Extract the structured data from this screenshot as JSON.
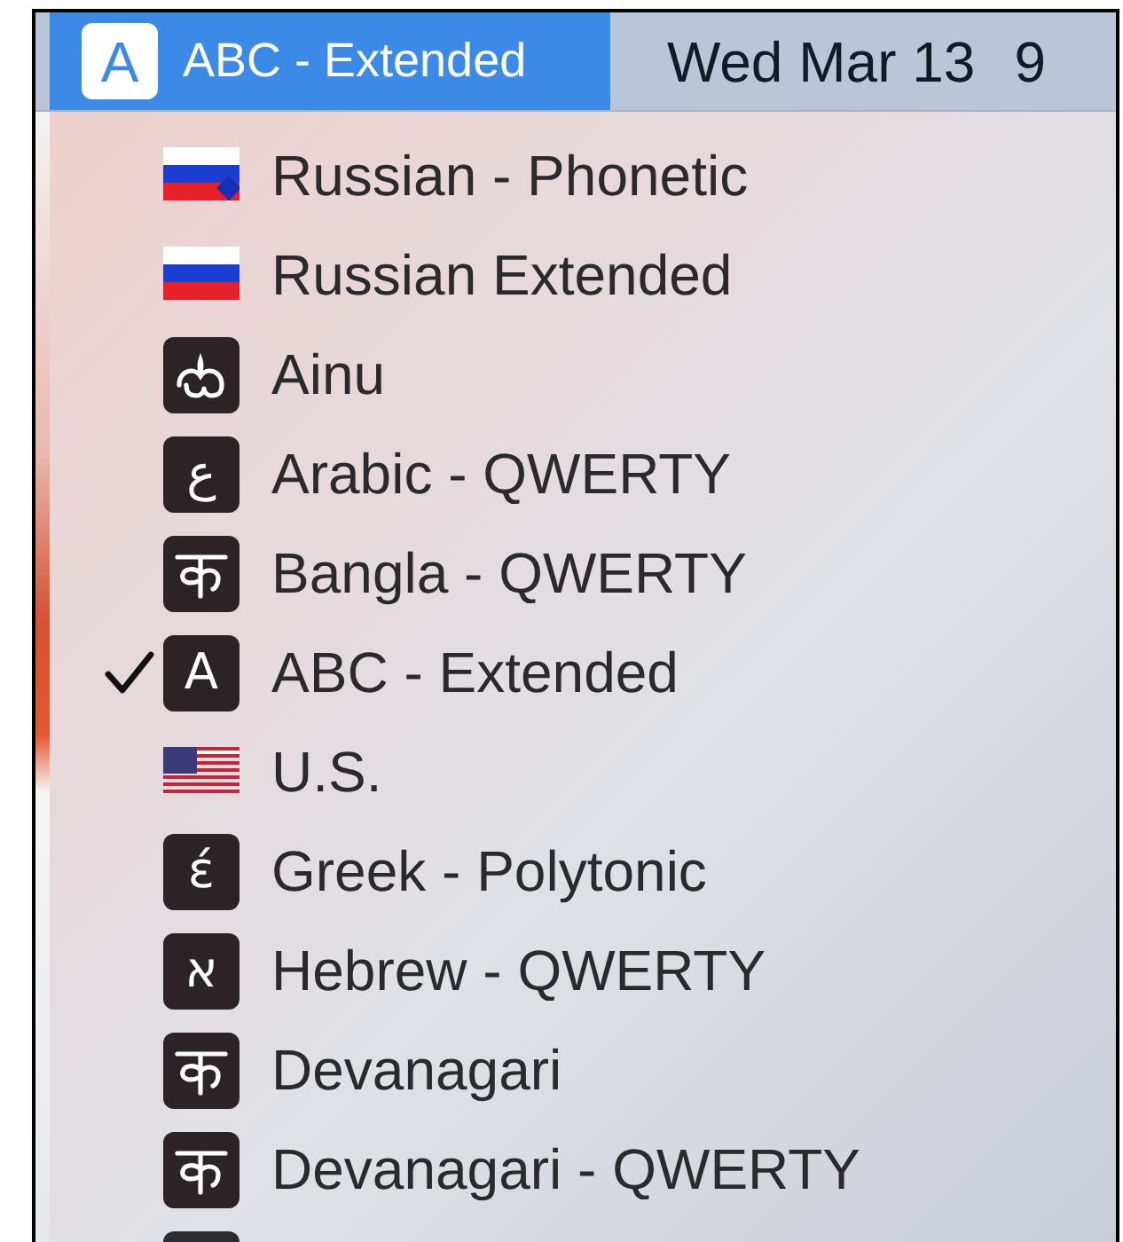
{
  "menu_bar": {
    "input_source": {
      "glyph": "A",
      "label": "ABC - Extended",
      "selected": true
    },
    "date": "Wed Mar 13",
    "time": "9"
  },
  "menu": {
    "items": [
      {
        "label": "Russian - Phonetic",
        "checked": false,
        "icon": {
          "kind": "flag-ru-phonetic"
        }
      },
      {
        "label": "Russian Extended",
        "checked": false,
        "icon": {
          "kind": "flag-ru"
        }
      },
      {
        "label": "Ainu",
        "checked": false,
        "icon": {
          "kind": "ainu"
        }
      },
      {
        "label": "Arabic - QWERTY",
        "checked": false,
        "icon": {
          "kind": "letter",
          "glyph": "ع"
        }
      },
      {
        "label": "Bangla - QWERTY",
        "checked": false,
        "icon": {
          "kind": "bangla"
        }
      },
      {
        "label": "ABC - Extended",
        "checked": true,
        "icon": {
          "kind": "letter",
          "glyph": "A"
        }
      },
      {
        "label": "U.S.",
        "checked": false,
        "icon": {
          "kind": "flag-us"
        }
      },
      {
        "label": "Greek - Polytonic",
        "checked": false,
        "icon": {
          "kind": "letter",
          "glyph": "έ"
        }
      },
      {
        "label": "Hebrew - QWERTY",
        "checked": false,
        "icon": {
          "kind": "letter",
          "glyph": "א"
        }
      },
      {
        "label": "Devanagari",
        "checked": false,
        "icon": {
          "kind": "devanagari"
        }
      },
      {
        "label": "Devanagari - QWERTY",
        "checked": false,
        "icon": {
          "kind": "devanagari"
        }
      },
      {
        "icon": {
          "kind": "blank"
        }
      }
    ]
  }
}
